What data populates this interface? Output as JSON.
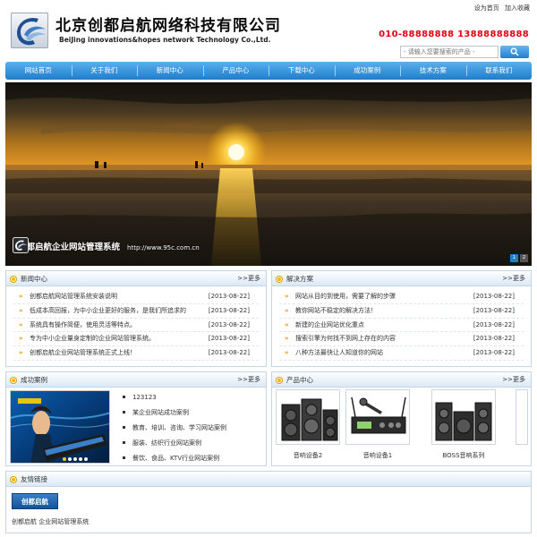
{
  "header": {
    "company_cn": "北京创都启航网络科技有限公司",
    "company_en": "BeiJing innovations&hopes network Technology Co.,Ltd.",
    "top_links": [
      "设为首页",
      "加入收藏"
    ],
    "phone": "010-88888888 13888888888",
    "search_placeholder": "- 请输入您要搜索的产品 -"
  },
  "nav": {
    "items": [
      "网站首页",
      "关于我们",
      "新闻中心",
      "产品中心",
      "下载中心",
      "成功案例",
      "技术方案",
      "联系我们"
    ]
  },
  "banner": {
    "caption": "创都启航企业网站管理系统",
    "url": "http://www.95c.com.cn",
    "pages": [
      "1",
      "2"
    ]
  },
  "news": {
    "title": "新闻中心",
    "more": ">>更多",
    "items": [
      {
        "text": "创都启航网站管理系统安装说明",
        "date": "[2013-08-22]"
      },
      {
        "text": "低成本高回报，为中小企业更好的服务，是我们所追求的",
        "date": "[2013-08-22]"
      },
      {
        "text": "系统具有操作简便，使用灵活等特点。",
        "date": "[2013-08-22]"
      },
      {
        "text": "专为中小企业量身定制的企业网站管理系统。",
        "date": "[2013-08-22]"
      },
      {
        "text": "创都启航企业网站管理系统正式上线！",
        "date": "[2013-08-22]"
      }
    ]
  },
  "solutions": {
    "title": "解决方案",
    "more": ">>更多",
    "items": [
      {
        "text": "网站从目的到使用，需要了解的步骤",
        "date": "[2013-08-22]"
      },
      {
        "text": "教你网站不稳定的解决方法！",
        "date": "[2013-08-22]"
      },
      {
        "text": "新建的企业网站优化重点",
        "date": "[2013-08-22]"
      },
      {
        "text": "搜索引擎为何找不到网上存在的内容",
        "date": "[2013-08-22]"
      },
      {
        "text": "八种方法最快让人知道你的网站",
        "date": "[2013-08-22]"
      }
    ]
  },
  "cases": {
    "title": "成功案例",
    "more": ">>更多",
    "items": [
      "123123",
      "某企业网站成功案例",
      "教育、培训、咨询、学习网站案例",
      "服装、纺织行业网站案例",
      "餐饮、食品、KTV行业网站案例"
    ]
  },
  "products": {
    "title": "产品中心",
    "more": ">>更多",
    "items": [
      "音响设备2",
      "音响设备1",
      "BOSS音响系列"
    ]
  },
  "links": {
    "title": "友情链接",
    "logo_text": "创都启航",
    "text": "创都启航 企业网站管理系统"
  },
  "colors": {
    "nav_blue": "#1e7dcc",
    "phone_red": "#e60012",
    "arrow_orange": "#f29400"
  }
}
